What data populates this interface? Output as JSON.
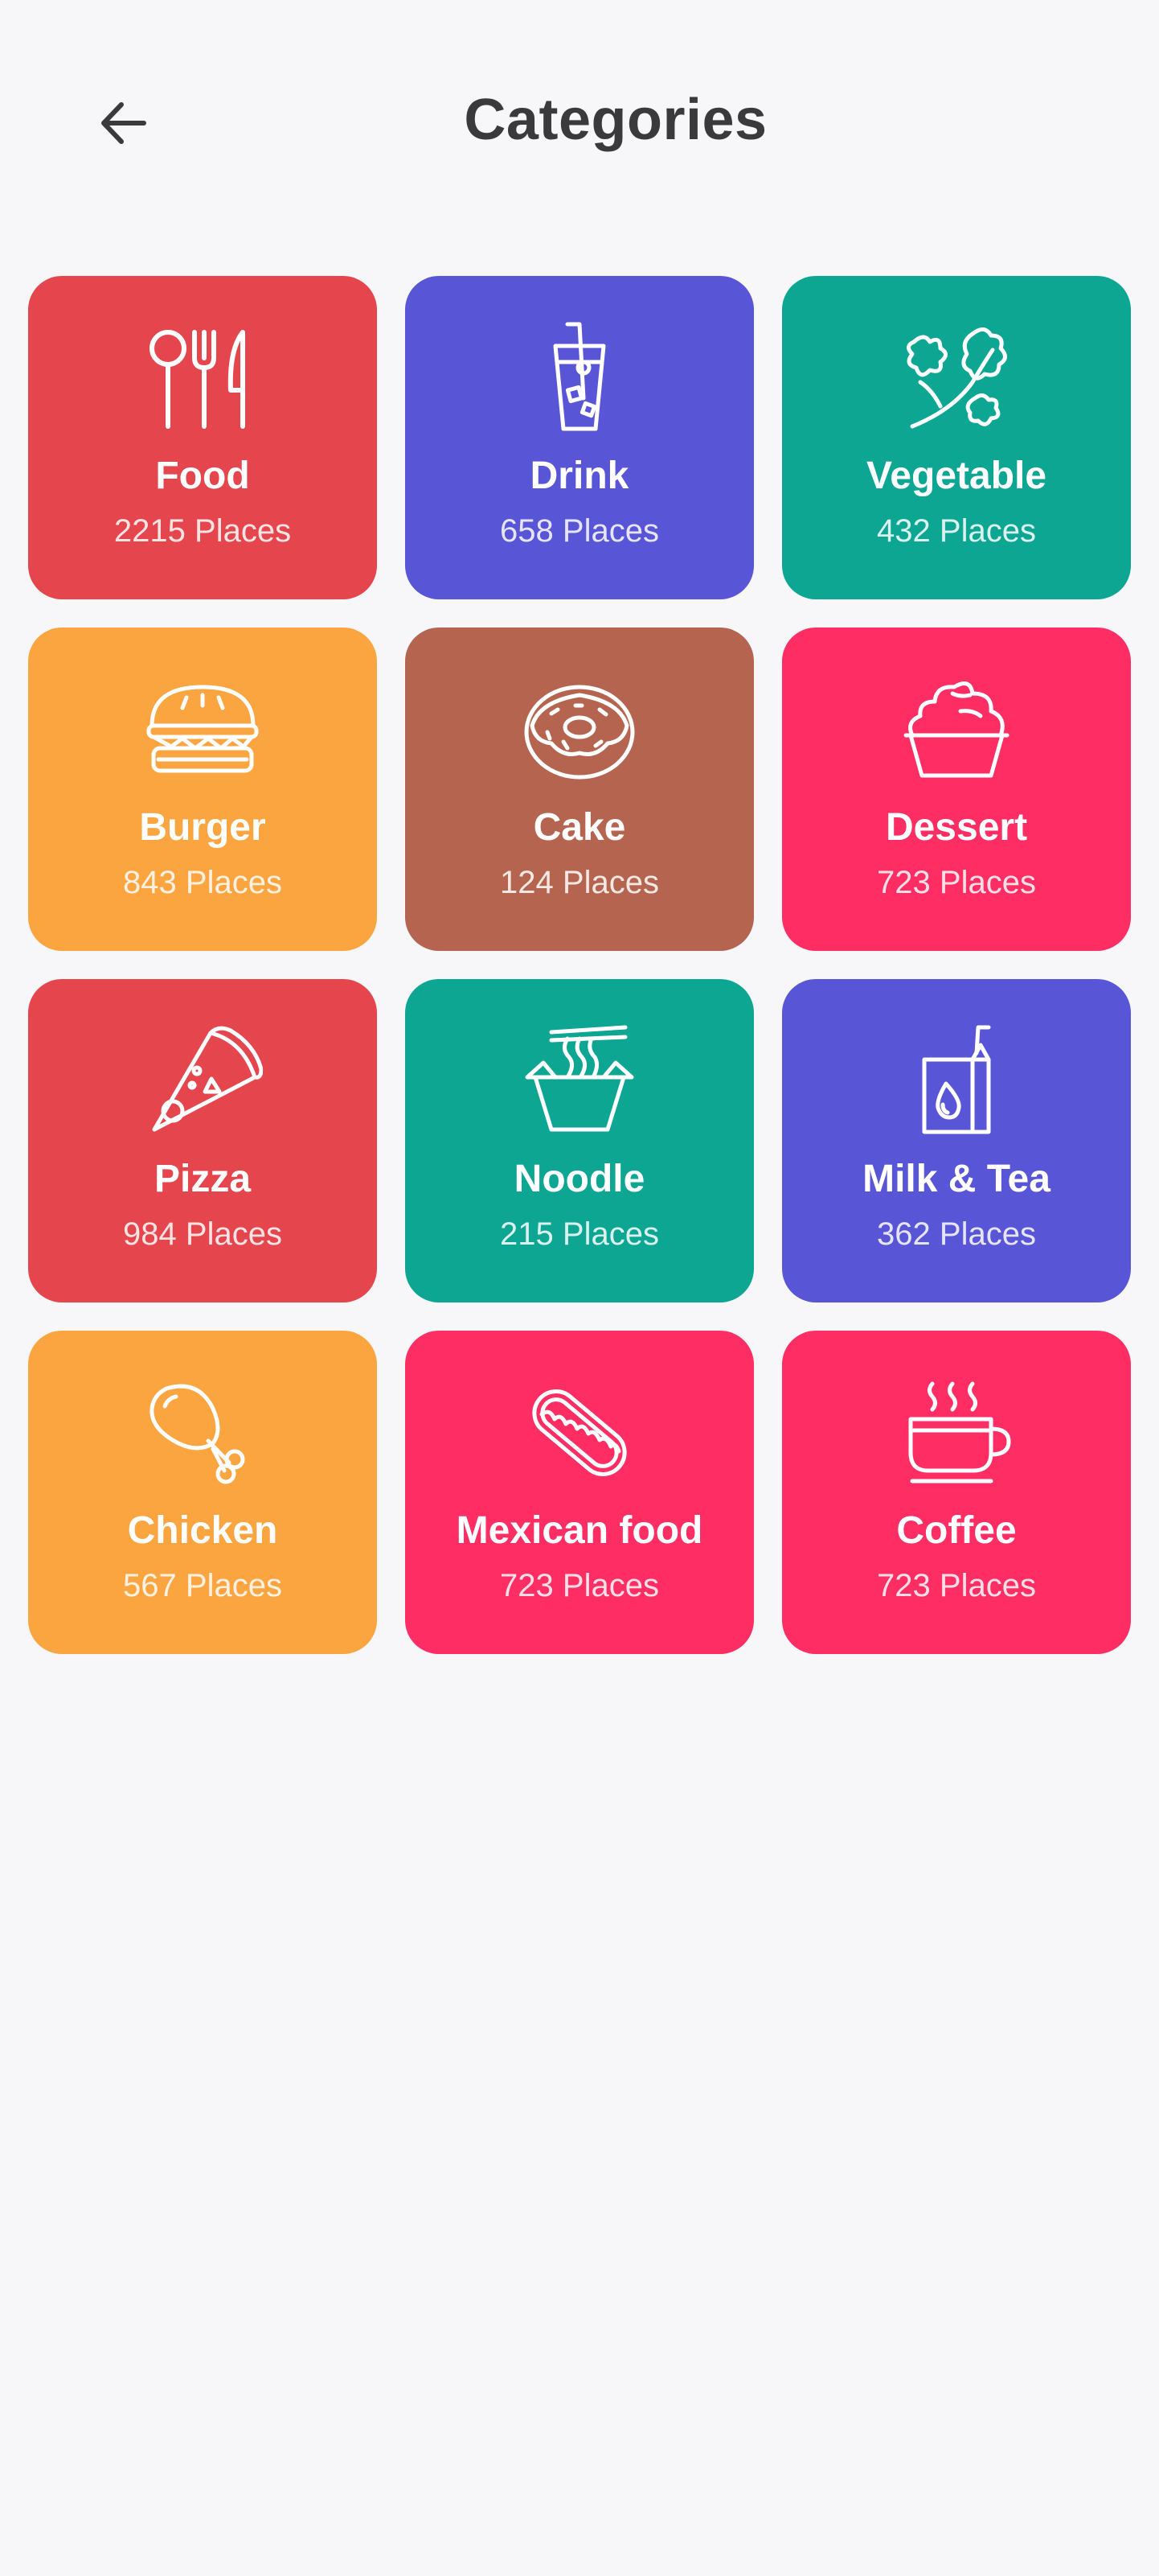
{
  "header": {
    "title": "Categories",
    "back_icon": "arrow-left-icon"
  },
  "colors": {
    "background": "#f7f7fa",
    "red": "#e5464e",
    "indigo": "#5855d6",
    "teal": "#0ca693",
    "orange": "#fba541",
    "brown": "#b5654f",
    "pink": "#fe2d63"
  },
  "categories": [
    {
      "name": "Food",
      "count": "2215 Places",
      "color": "#e5464e",
      "icon": "utensils-icon"
    },
    {
      "name": "Drink",
      "count": "658 Places",
      "color": "#5855d6",
      "icon": "drink-glass-icon"
    },
    {
      "name": "Vegetable",
      "count": "432 Places",
      "color": "#0ca693",
      "icon": "vegetable-icon"
    },
    {
      "name": "Burger",
      "count": "843 Places",
      "color": "#fba541",
      "icon": "burger-icon"
    },
    {
      "name": "Cake",
      "count": "124 Places",
      "color": "#b5654f",
      "icon": "donut-icon"
    },
    {
      "name": "Dessert",
      "count": "723 Places",
      "color": "#fe2d63",
      "icon": "ice-cream-icon"
    },
    {
      "name": "Pizza",
      "count": "984 Places",
      "color": "#e5464e",
      "icon": "pizza-icon"
    },
    {
      "name": "Noodle",
      "count": "215 Places",
      "color": "#0ca693",
      "icon": "noodle-box-icon"
    },
    {
      "name": "Milk & Tea",
      "count": "362 Places",
      "color": "#5855d6",
      "icon": "milk-carton-icon"
    },
    {
      "name": "Chicken",
      "count": "567 Places",
      "color": "#fba541",
      "icon": "chicken-leg-icon"
    },
    {
      "name": "Mexican food",
      "count": "723 Places",
      "color": "#fe2d63",
      "icon": "hotdog-icon"
    },
    {
      "name": "Coffee",
      "count": "723 Places",
      "color": "#fe2d63",
      "icon": "coffee-cup-icon"
    }
  ]
}
